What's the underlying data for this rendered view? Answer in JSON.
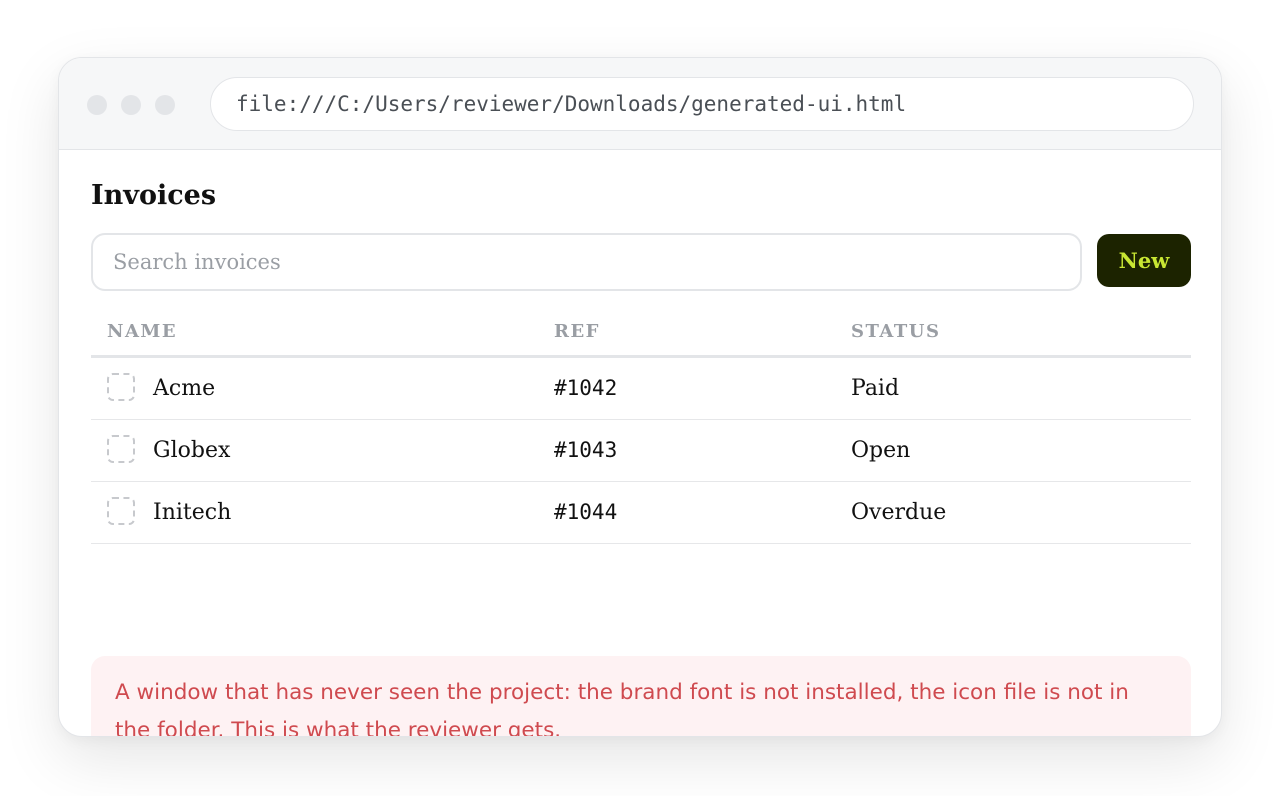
{
  "browser": {
    "url": "file:///C:/Users/reviewer/Downloads/generated-ui.html"
  },
  "page": {
    "title": "Invoices",
    "search": {
      "placeholder": "Search invoices",
      "value": ""
    },
    "new_button_label": "New"
  },
  "table": {
    "columns": [
      "NAME",
      "REF",
      "STATUS"
    ],
    "rows": [
      {
        "name": "Acme",
        "ref": "#1042",
        "status": "Paid"
      },
      {
        "name": "Globex",
        "ref": "#1043",
        "status": "Open"
      },
      {
        "name": "Initech",
        "ref": "#1044",
        "status": "Overdue"
      }
    ]
  },
  "notice": {
    "text": "A window that has never seen the project: the brand font is not installed, the icon file is not in the folder. This is what the reviewer gets."
  },
  "colors": {
    "accent_button_bg": "#1c2300",
    "accent_button_text": "#c8e633",
    "notice_bg": "#fef2f3",
    "notice_text": "#cf4a4f"
  }
}
